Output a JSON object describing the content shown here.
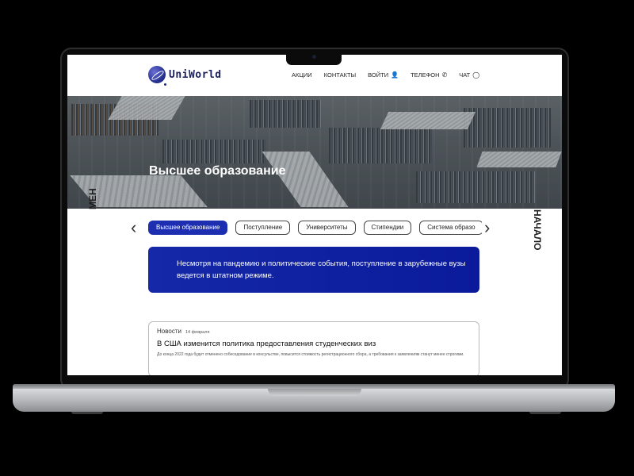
{
  "header": {
    "logo_text": "UniWorld",
    "nav": [
      {
        "label": "АКЦИИ",
        "icon": ""
      },
      {
        "label": "КОНТАКТЫ",
        "icon": ""
      },
      {
        "label": "ВОЙТИ",
        "icon": "👤"
      },
      {
        "label": "ТЕЛЕФОН",
        "icon": "✆"
      },
      {
        "label": "ЧАТ",
        "icon": "◯"
      }
    ]
  },
  "hero": {
    "title": "Высшее образование"
  },
  "side": {
    "left_label": "МЕН",
    "right_label": "НАЧАЛО"
  },
  "tabs": {
    "prev_icon": "‹",
    "next_icon": "›",
    "items": [
      {
        "label": "Высшее образование",
        "active": true
      },
      {
        "label": "Поступление",
        "active": false
      },
      {
        "label": "Университеты",
        "active": false
      },
      {
        "label": "Стипендии",
        "active": false
      },
      {
        "label": "Система образо",
        "active": false
      }
    ]
  },
  "notice": {
    "text": "Несмотря на пандемию и политические события, поступление в зарубежные вузы ведется в штатном режиме."
  },
  "news": {
    "tag": "Новости",
    "date": "14 февраля",
    "title": "В США изменится политика предоставления студенческих виз",
    "text": "До конца 2022 года будет отменено собеседование в консульстве, повысится стоимость регистрационного сбора, а требования к заявлениям станут менее строгими."
  },
  "colors": {
    "brand_blue": "#1d2fb0",
    "notice_bg": "#1428a8",
    "logo_text": "#1a1f5c"
  }
}
